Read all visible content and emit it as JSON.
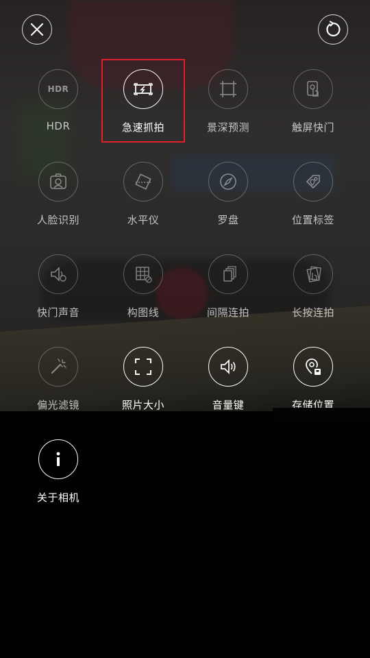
{
  "colors": {
    "highlight": "#e0202a",
    "icon_active": "#ffffff"
  },
  "topbar": {
    "close_icon": "close-icon",
    "reset_icon": "reset-icon"
  },
  "menu": {
    "items": [
      {
        "label": "HDR",
        "icon": "hdr-icon",
        "icon_text": "HDR",
        "state": "dim"
      },
      {
        "label": "急速抓拍",
        "icon": "rapid-capture-icon",
        "state": "bright",
        "highlighted": true
      },
      {
        "label": "景深预测",
        "icon": "depth-of-field-icon",
        "state": "dim"
      },
      {
        "label": "触屏快门",
        "icon": "touch-shutter-icon",
        "state": "dim"
      },
      {
        "label": "人脸识别",
        "icon": "face-recognition-icon",
        "state": "dim"
      },
      {
        "label": "水平仪",
        "icon": "level-icon",
        "state": "dim"
      },
      {
        "label": "罗盘",
        "icon": "compass-icon",
        "state": "dim"
      },
      {
        "label": "位置标签",
        "icon": "location-tag-icon",
        "state": "dim"
      },
      {
        "label": "快门声音",
        "icon": "shutter-sound-icon",
        "state": "dim"
      },
      {
        "label": "构图线",
        "icon": "grid-lines-icon",
        "state": "dim"
      },
      {
        "label": "间隔连拍",
        "icon": "interval-burst-icon",
        "state": "dim"
      },
      {
        "label": "长按连拍",
        "icon": "long-press-burst-icon",
        "state": "dim"
      },
      {
        "label": "偏光滤镜",
        "icon": "polarizer-icon",
        "state": "dim"
      },
      {
        "label": "照片大小",
        "icon": "photo-size-icon",
        "state": "bright"
      },
      {
        "label": "音量键",
        "icon": "volume-key-icon",
        "state": "bright"
      },
      {
        "label": "存储位置",
        "icon": "storage-location-icon",
        "state": "bright"
      },
      {
        "label": "关于相机",
        "icon": "info-icon",
        "state": "bright"
      }
    ]
  }
}
